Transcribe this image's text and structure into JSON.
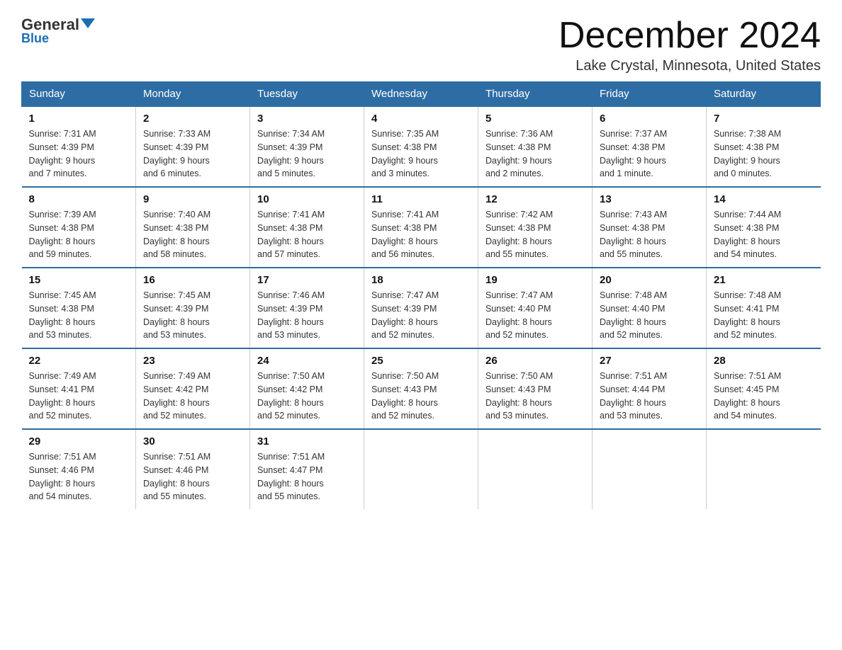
{
  "logo": {
    "general": "General",
    "blue": "Blue"
  },
  "header": {
    "month_title": "December 2024",
    "location": "Lake Crystal, Minnesota, United States"
  },
  "days_of_week": [
    "Sunday",
    "Monday",
    "Tuesday",
    "Wednesday",
    "Thursday",
    "Friday",
    "Saturday"
  ],
  "weeks": [
    [
      {
        "day": 1,
        "sunrise": "7:31 AM",
        "sunset": "4:39 PM",
        "daylight": "9 hours and 7 minutes."
      },
      {
        "day": 2,
        "sunrise": "7:33 AM",
        "sunset": "4:39 PM",
        "daylight": "9 hours and 6 minutes."
      },
      {
        "day": 3,
        "sunrise": "7:34 AM",
        "sunset": "4:39 PM",
        "daylight": "9 hours and 5 minutes."
      },
      {
        "day": 4,
        "sunrise": "7:35 AM",
        "sunset": "4:38 PM",
        "daylight": "9 hours and 3 minutes."
      },
      {
        "day": 5,
        "sunrise": "7:36 AM",
        "sunset": "4:38 PM",
        "daylight": "9 hours and 2 minutes."
      },
      {
        "day": 6,
        "sunrise": "7:37 AM",
        "sunset": "4:38 PM",
        "daylight": "9 hours and 1 minute."
      },
      {
        "day": 7,
        "sunrise": "7:38 AM",
        "sunset": "4:38 PM",
        "daylight": "9 hours and 0 minutes."
      }
    ],
    [
      {
        "day": 8,
        "sunrise": "7:39 AM",
        "sunset": "4:38 PM",
        "daylight": "8 hours and 59 minutes."
      },
      {
        "day": 9,
        "sunrise": "7:40 AM",
        "sunset": "4:38 PM",
        "daylight": "8 hours and 58 minutes."
      },
      {
        "day": 10,
        "sunrise": "7:41 AM",
        "sunset": "4:38 PM",
        "daylight": "8 hours and 57 minutes."
      },
      {
        "day": 11,
        "sunrise": "7:41 AM",
        "sunset": "4:38 PM",
        "daylight": "8 hours and 56 minutes."
      },
      {
        "day": 12,
        "sunrise": "7:42 AM",
        "sunset": "4:38 PM",
        "daylight": "8 hours and 55 minutes."
      },
      {
        "day": 13,
        "sunrise": "7:43 AM",
        "sunset": "4:38 PM",
        "daylight": "8 hours and 55 minutes."
      },
      {
        "day": 14,
        "sunrise": "7:44 AM",
        "sunset": "4:38 PM",
        "daylight": "8 hours and 54 minutes."
      }
    ],
    [
      {
        "day": 15,
        "sunrise": "7:45 AM",
        "sunset": "4:38 PM",
        "daylight": "8 hours and 53 minutes."
      },
      {
        "day": 16,
        "sunrise": "7:45 AM",
        "sunset": "4:39 PM",
        "daylight": "8 hours and 53 minutes."
      },
      {
        "day": 17,
        "sunrise": "7:46 AM",
        "sunset": "4:39 PM",
        "daylight": "8 hours and 53 minutes."
      },
      {
        "day": 18,
        "sunrise": "7:47 AM",
        "sunset": "4:39 PM",
        "daylight": "8 hours and 52 minutes."
      },
      {
        "day": 19,
        "sunrise": "7:47 AM",
        "sunset": "4:40 PM",
        "daylight": "8 hours and 52 minutes."
      },
      {
        "day": 20,
        "sunrise": "7:48 AM",
        "sunset": "4:40 PM",
        "daylight": "8 hours and 52 minutes."
      },
      {
        "day": 21,
        "sunrise": "7:48 AM",
        "sunset": "4:41 PM",
        "daylight": "8 hours and 52 minutes."
      }
    ],
    [
      {
        "day": 22,
        "sunrise": "7:49 AM",
        "sunset": "4:41 PM",
        "daylight": "8 hours and 52 minutes."
      },
      {
        "day": 23,
        "sunrise": "7:49 AM",
        "sunset": "4:42 PM",
        "daylight": "8 hours and 52 minutes."
      },
      {
        "day": 24,
        "sunrise": "7:50 AM",
        "sunset": "4:42 PM",
        "daylight": "8 hours and 52 minutes."
      },
      {
        "day": 25,
        "sunrise": "7:50 AM",
        "sunset": "4:43 PM",
        "daylight": "8 hours and 52 minutes."
      },
      {
        "day": 26,
        "sunrise": "7:50 AM",
        "sunset": "4:43 PM",
        "daylight": "8 hours and 53 minutes."
      },
      {
        "day": 27,
        "sunrise": "7:51 AM",
        "sunset": "4:44 PM",
        "daylight": "8 hours and 53 minutes."
      },
      {
        "day": 28,
        "sunrise": "7:51 AM",
        "sunset": "4:45 PM",
        "daylight": "8 hours and 54 minutes."
      }
    ],
    [
      {
        "day": 29,
        "sunrise": "7:51 AM",
        "sunset": "4:46 PM",
        "daylight": "8 hours and 54 minutes."
      },
      {
        "day": 30,
        "sunrise": "7:51 AM",
        "sunset": "4:46 PM",
        "daylight": "8 hours and 55 minutes."
      },
      {
        "day": 31,
        "sunrise": "7:51 AM",
        "sunset": "4:47 PM",
        "daylight": "8 hours and 55 minutes."
      },
      null,
      null,
      null,
      null
    ]
  ],
  "labels": {
    "sunrise": "Sunrise:",
    "sunset": "Sunset:",
    "daylight": "Daylight:"
  }
}
